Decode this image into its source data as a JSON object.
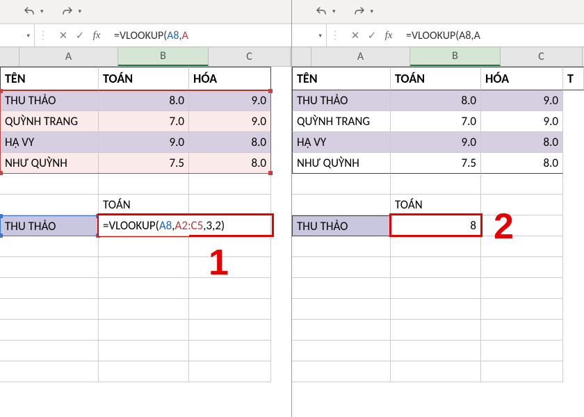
{
  "toolbar": {
    "undo_icon": "undo",
    "redo_icon": "redo"
  },
  "formula_bar": {
    "cancel": "✕",
    "confirm": "✓",
    "fx": "fx",
    "text1_prefix": "=VLOOKUP(",
    "text1_a": "A8",
    "text1_sep": ",",
    "text1_b": "A",
    "text2": "=VLOOKUP(A8,A"
  },
  "columns": {
    "A": "A",
    "B": "B",
    "C": "C"
  },
  "headers": {
    "name": "TÊN",
    "math": "TOÁN",
    "chem": "HÓA",
    "extra": "T"
  },
  "rows": [
    {
      "name": "THU THẢO",
      "math": "8.0",
      "chem": "9.0"
    },
    {
      "name": "QUỲNH TRANG",
      "math": "7.0",
      "chem": "9.0"
    },
    {
      "name": "HẠ VY",
      "math": "9.0",
      "chem": "8.0"
    },
    {
      "name": "NHƯ QUỲNH",
      "math": "7.5",
      "chem": "8.0"
    }
  ],
  "lookup": {
    "label": "TOÁN",
    "name": "THU THẢO",
    "formula_prefix": "=VLOOKUP(",
    "formula_a8": "A8",
    "formula_comma1": ",",
    "formula_range": "A2:C5",
    "formula_rest": ",3,2)",
    "result": "8"
  },
  "steps": {
    "one": "1",
    "two": "2"
  },
  "chart_data": {
    "type": "table",
    "title": "VLOOKUP example (before and after)",
    "columns": [
      "TÊN",
      "TOÁN",
      "HÓA"
    ],
    "rows": [
      [
        "THU THẢO",
        8.0,
        9.0
      ],
      [
        "QUỲNH TRANG",
        7.0,
        9.0
      ],
      [
        "HẠ VY",
        9.0,
        8.0
      ],
      [
        "NHƯ QUỲNH",
        7.5,
        8.0
      ]
    ],
    "lookup_cell_formula": "=VLOOKUP(A8,A2:C5,3,2)",
    "lookup_key": "THU THẢO",
    "lookup_result": 8
  }
}
